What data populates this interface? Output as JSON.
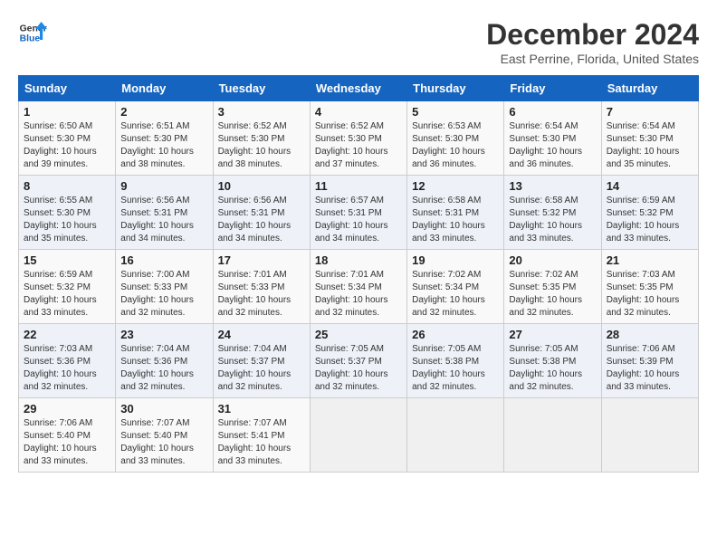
{
  "header": {
    "logo_line1": "General",
    "logo_line2": "Blue",
    "month": "December 2024",
    "location": "East Perrine, Florida, United States"
  },
  "weekdays": [
    "Sunday",
    "Monday",
    "Tuesday",
    "Wednesday",
    "Thursday",
    "Friday",
    "Saturday"
  ],
  "weeks": [
    [
      {
        "day": "1",
        "info": "Sunrise: 6:50 AM\nSunset: 5:30 PM\nDaylight: 10 hours\nand 39 minutes."
      },
      {
        "day": "2",
        "info": "Sunrise: 6:51 AM\nSunset: 5:30 PM\nDaylight: 10 hours\nand 38 minutes."
      },
      {
        "day": "3",
        "info": "Sunrise: 6:52 AM\nSunset: 5:30 PM\nDaylight: 10 hours\nand 38 minutes."
      },
      {
        "day": "4",
        "info": "Sunrise: 6:52 AM\nSunset: 5:30 PM\nDaylight: 10 hours\nand 37 minutes."
      },
      {
        "day": "5",
        "info": "Sunrise: 6:53 AM\nSunset: 5:30 PM\nDaylight: 10 hours\nand 36 minutes."
      },
      {
        "day": "6",
        "info": "Sunrise: 6:54 AM\nSunset: 5:30 PM\nDaylight: 10 hours\nand 36 minutes."
      },
      {
        "day": "7",
        "info": "Sunrise: 6:54 AM\nSunset: 5:30 PM\nDaylight: 10 hours\nand 35 minutes."
      }
    ],
    [
      {
        "day": "8",
        "info": "Sunrise: 6:55 AM\nSunset: 5:30 PM\nDaylight: 10 hours\nand 35 minutes."
      },
      {
        "day": "9",
        "info": "Sunrise: 6:56 AM\nSunset: 5:31 PM\nDaylight: 10 hours\nand 34 minutes."
      },
      {
        "day": "10",
        "info": "Sunrise: 6:56 AM\nSunset: 5:31 PM\nDaylight: 10 hours\nand 34 minutes."
      },
      {
        "day": "11",
        "info": "Sunrise: 6:57 AM\nSunset: 5:31 PM\nDaylight: 10 hours\nand 34 minutes."
      },
      {
        "day": "12",
        "info": "Sunrise: 6:58 AM\nSunset: 5:31 PM\nDaylight: 10 hours\nand 33 minutes."
      },
      {
        "day": "13",
        "info": "Sunrise: 6:58 AM\nSunset: 5:32 PM\nDaylight: 10 hours\nand 33 minutes."
      },
      {
        "day": "14",
        "info": "Sunrise: 6:59 AM\nSunset: 5:32 PM\nDaylight: 10 hours\nand 33 minutes."
      }
    ],
    [
      {
        "day": "15",
        "info": "Sunrise: 6:59 AM\nSunset: 5:32 PM\nDaylight: 10 hours\nand 33 minutes."
      },
      {
        "day": "16",
        "info": "Sunrise: 7:00 AM\nSunset: 5:33 PM\nDaylight: 10 hours\nand 32 minutes."
      },
      {
        "day": "17",
        "info": "Sunrise: 7:01 AM\nSunset: 5:33 PM\nDaylight: 10 hours\nand 32 minutes."
      },
      {
        "day": "18",
        "info": "Sunrise: 7:01 AM\nSunset: 5:34 PM\nDaylight: 10 hours\nand 32 minutes."
      },
      {
        "day": "19",
        "info": "Sunrise: 7:02 AM\nSunset: 5:34 PM\nDaylight: 10 hours\nand 32 minutes."
      },
      {
        "day": "20",
        "info": "Sunrise: 7:02 AM\nSunset: 5:35 PM\nDaylight: 10 hours\nand 32 minutes."
      },
      {
        "day": "21",
        "info": "Sunrise: 7:03 AM\nSunset: 5:35 PM\nDaylight: 10 hours\nand 32 minutes."
      }
    ],
    [
      {
        "day": "22",
        "info": "Sunrise: 7:03 AM\nSunset: 5:36 PM\nDaylight: 10 hours\nand 32 minutes."
      },
      {
        "day": "23",
        "info": "Sunrise: 7:04 AM\nSunset: 5:36 PM\nDaylight: 10 hours\nand 32 minutes."
      },
      {
        "day": "24",
        "info": "Sunrise: 7:04 AM\nSunset: 5:37 PM\nDaylight: 10 hours\nand 32 minutes."
      },
      {
        "day": "25",
        "info": "Sunrise: 7:05 AM\nSunset: 5:37 PM\nDaylight: 10 hours\nand 32 minutes."
      },
      {
        "day": "26",
        "info": "Sunrise: 7:05 AM\nSunset: 5:38 PM\nDaylight: 10 hours\nand 32 minutes."
      },
      {
        "day": "27",
        "info": "Sunrise: 7:05 AM\nSunset: 5:38 PM\nDaylight: 10 hours\nand 32 minutes."
      },
      {
        "day": "28",
        "info": "Sunrise: 7:06 AM\nSunset: 5:39 PM\nDaylight: 10 hours\nand 33 minutes."
      }
    ],
    [
      {
        "day": "29",
        "info": "Sunrise: 7:06 AM\nSunset: 5:40 PM\nDaylight: 10 hours\nand 33 minutes."
      },
      {
        "day": "30",
        "info": "Sunrise: 7:07 AM\nSunset: 5:40 PM\nDaylight: 10 hours\nand 33 minutes."
      },
      {
        "day": "31",
        "info": "Sunrise: 7:07 AM\nSunset: 5:41 PM\nDaylight: 10 hours\nand 33 minutes."
      },
      {
        "day": "",
        "info": ""
      },
      {
        "day": "",
        "info": ""
      },
      {
        "day": "",
        "info": ""
      },
      {
        "day": "",
        "info": ""
      }
    ]
  ]
}
